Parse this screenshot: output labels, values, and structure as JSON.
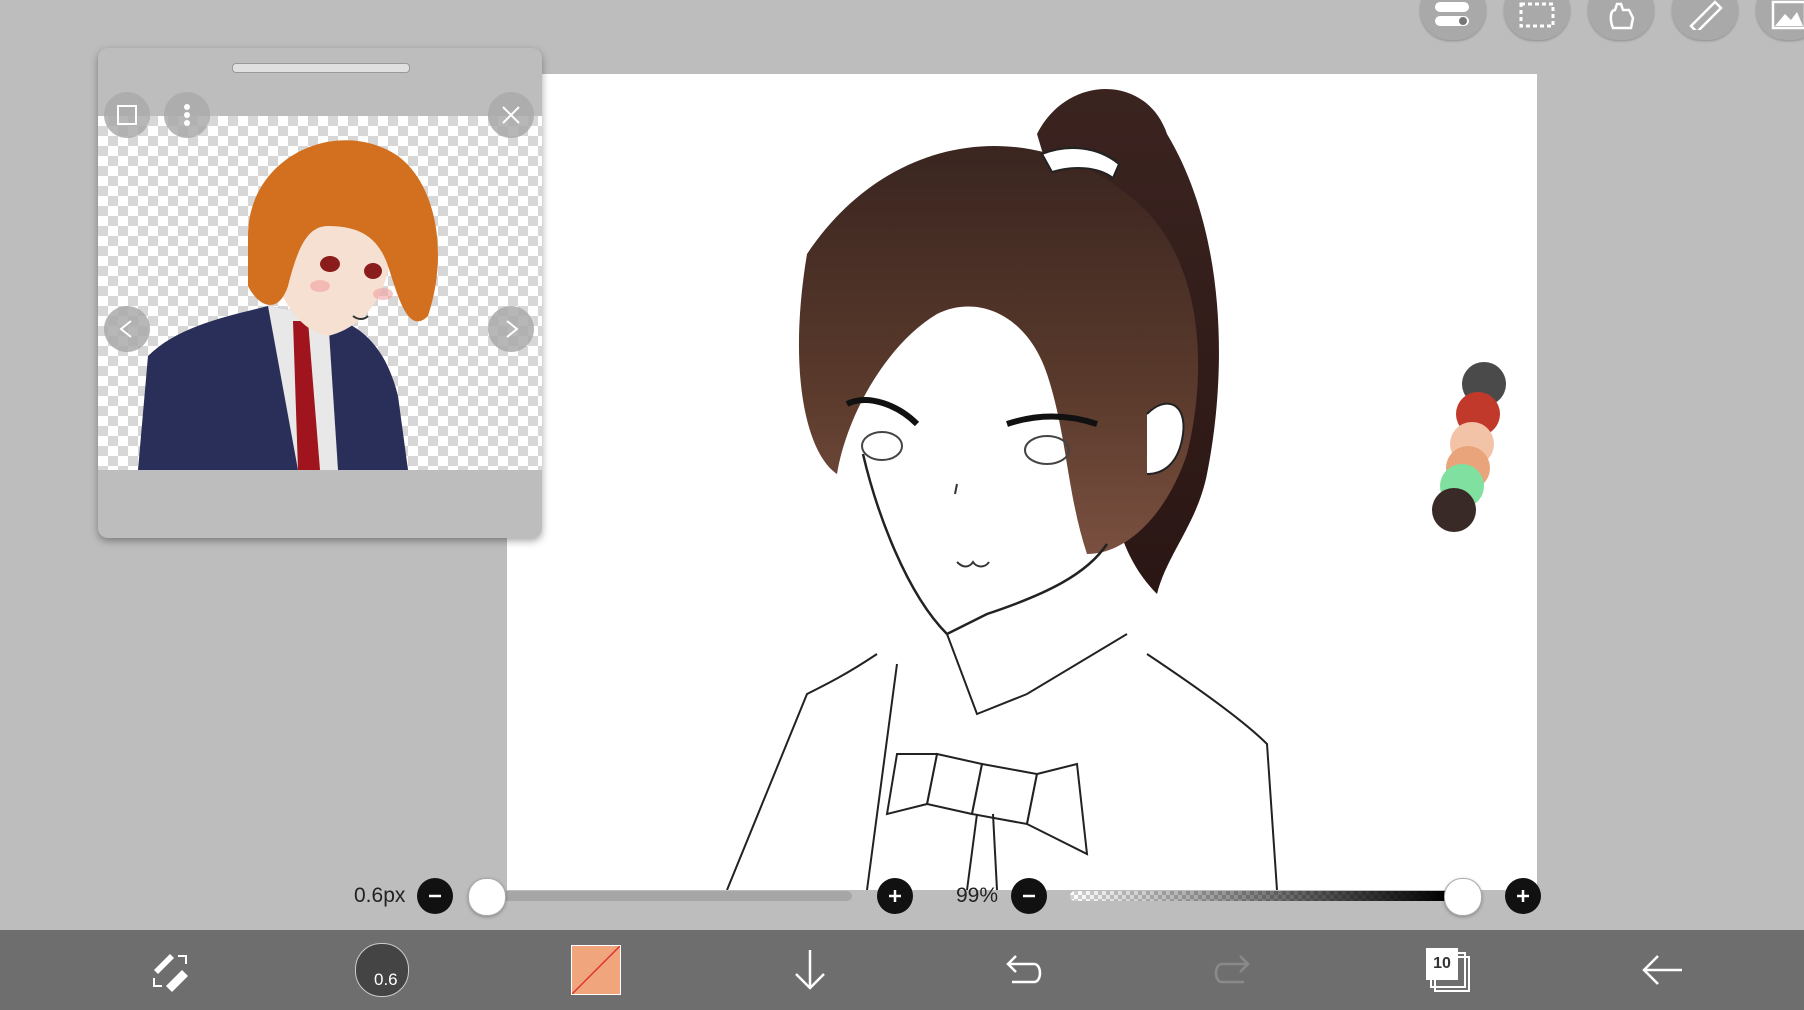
{
  "top_toolbar": {
    "buttons": [
      "toggle-icon",
      "selection-icon",
      "hand-icon",
      "ruler-icon",
      "image-icon"
    ]
  },
  "reference_window": {
    "buttons": [
      "layer-icon",
      "more-icon",
      "close-icon",
      "prev-icon",
      "next-icon"
    ]
  },
  "brush_size": {
    "label": "0.6px",
    "value_fraction": 0.0
  },
  "opacity": {
    "label": "99%",
    "value_fraction": 0.99
  },
  "bottom_bar": {
    "brush_size_badge": "0.6",
    "layers_count": "10",
    "current_color": "#f0a57c"
  },
  "palette_colors": [
    "#4a4a4a",
    "#c0392b",
    "#f3c3a8",
    "#e9a47b",
    "#7fe0a0",
    "#3a2a27"
  ],
  "colors": {
    "background": "#bdbdbd",
    "bar": "#6e6e6e",
    "hair": "#4a2c22"
  }
}
